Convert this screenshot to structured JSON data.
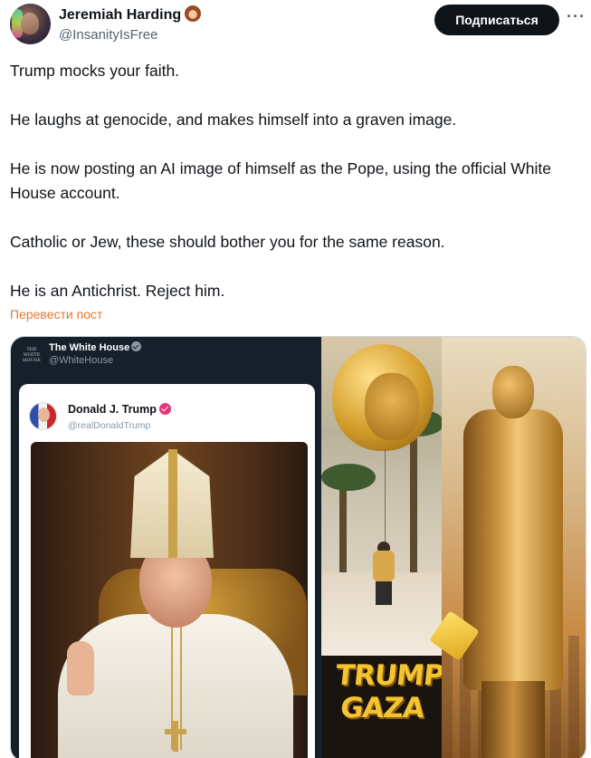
{
  "tweet": {
    "author_name": "Jeremiah Harding",
    "author_handle": "@InsanityIsFree",
    "subscribe_label": "Подписаться",
    "more_icon": "more-horizontal-icon",
    "paragraphs": [
      "Trump mocks your faith.",
      "He laughs at genocide, and makes himself into a graven image.",
      "He is now posting an AI image of himself as the Pope, using the official White House account.",
      "Catholic or Jew, these should bother you for the same reason.",
      "He is an Antichrist. Reject him."
    ],
    "translate_label": "Перевести пост"
  },
  "media": {
    "embedded_account_name": "The White House",
    "embedded_account_handle": "@WhiteHouse",
    "embedded_logo_text": "THE WHITE HOUSE",
    "quoted_name": "Donald J. Trump",
    "quoted_handle": "@realDonaldTrump",
    "sign_line1": "TRUMP",
    "sign_line2": "GAZA"
  },
  "colors": {
    "subscribe_bg": "#0f1419",
    "translate_link": "#e8772e",
    "embedded_panel_bg": "#15202b",
    "verified_pink": "#e6337a"
  }
}
